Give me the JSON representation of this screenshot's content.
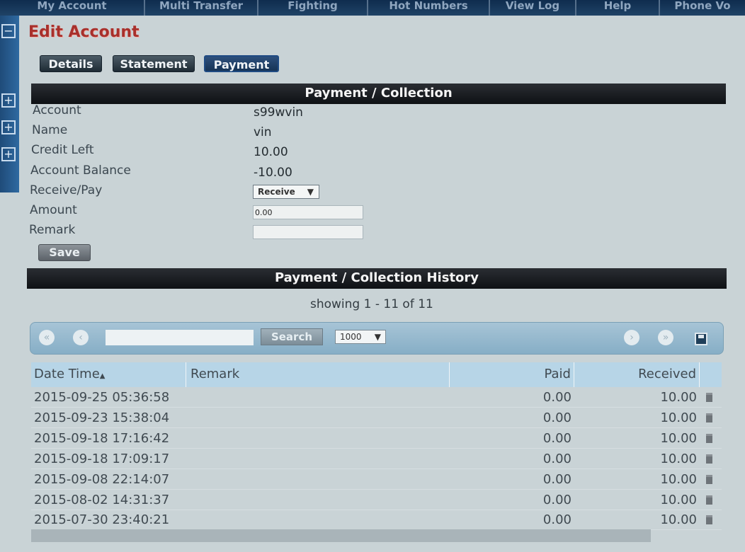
{
  "nav": {
    "items": [
      {
        "label": "My Account"
      },
      {
        "label": "Multi Transfer"
      },
      {
        "label": "Fighting"
      },
      {
        "label": "Hot Numbers"
      },
      {
        "label": "View Log"
      },
      {
        "label": "Help"
      },
      {
        "label": "Phone Vo"
      }
    ]
  },
  "page": {
    "title": "Edit Account",
    "tabs": [
      {
        "label": "Details"
      },
      {
        "label": "Statement"
      },
      {
        "label": "Payment",
        "active": true
      }
    ]
  },
  "form": {
    "section_title": "Payment / Collection",
    "fields": [
      {
        "label": "Account",
        "value": "s99wvin"
      },
      {
        "label": "Name",
        "value": "vin"
      },
      {
        "label": "Credit Left",
        "value": "10.00"
      },
      {
        "label": "Account Balance",
        "value": "-10.00"
      },
      {
        "label": "Receive/Pay",
        "value": "Receive"
      },
      {
        "label": "Amount",
        "value": "0.00"
      },
      {
        "label": "Remark",
        "value": ""
      }
    ],
    "save_label": "Save"
  },
  "history": {
    "section_title": "Payment / Collection History",
    "showing": "showing 1 - 11 of 11",
    "toolbar": {
      "search_label": "Search",
      "search_value": "",
      "page_size": "1000"
    },
    "columns": [
      "Date Time",
      "Remark",
      "Paid",
      "Received"
    ],
    "rows": [
      {
        "date": "2015-09-25 05:36:58",
        "remark": "",
        "paid": "0.00",
        "received": "10.00"
      },
      {
        "date": "2015-09-23 15:38:04",
        "remark": "",
        "paid": "0.00",
        "received": "10.00"
      },
      {
        "date": "2015-09-18 17:16:42",
        "remark": "",
        "paid": "0.00",
        "received": "10.00"
      },
      {
        "date": "2015-09-18 17:09:17",
        "remark": "",
        "paid": "0.00",
        "received": "10.00"
      },
      {
        "date": "2015-09-08 22:14:07",
        "remark": "",
        "paid": "0.00",
        "received": "10.00"
      },
      {
        "date": "2015-08-02 14:31:37",
        "remark": "",
        "paid": "0.00",
        "received": "10.00"
      },
      {
        "date": "2015-07-30 23:40:21",
        "remark": "",
        "paid": "0.00",
        "received": "10.00"
      }
    ]
  },
  "colors": {
    "title": "#a8302c",
    "section_bar": "#16191c",
    "grid_header": "#b7d5e7",
    "toolbar": "#95b8cd"
  }
}
